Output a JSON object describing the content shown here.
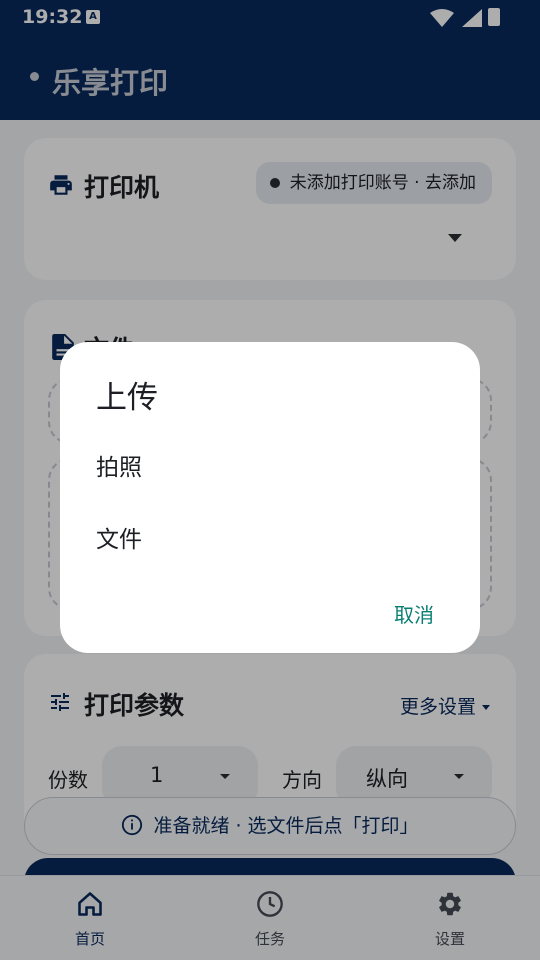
{
  "status_bar": {
    "time": "19:32",
    "badge": "A"
  },
  "app": {
    "title": "乐享打印"
  },
  "printer_card": {
    "title": "打印机",
    "chip_label": "未添加打印账号 · 去添加",
    "icon": "printer-icon"
  },
  "file_card": {
    "title": "文件",
    "icon": "file-icon"
  },
  "params_card": {
    "title": "打印参数",
    "more_label": "更多设置",
    "copies_label": "份数",
    "copies_value": "1",
    "orientation_label": "方向",
    "orientation_value": "纵向",
    "icon": "tune-icon"
  },
  "status_message": "准备就绪 · 选文件后点「打印」",
  "bottom_nav": [
    {
      "label": "首页",
      "icon": "home-icon",
      "active": true
    },
    {
      "label": "任务",
      "icon": "clock-icon",
      "active": false
    },
    {
      "label": "设置",
      "icon": "gear-icon",
      "active": false
    }
  ],
  "dialog": {
    "title": "上传",
    "options": [
      "拍照",
      "文件"
    ],
    "cancel_label": "取消"
  },
  "colors": {
    "primary": "#0a2a5c",
    "accent_teal": "#0b7e74",
    "background": "#f1f3f7",
    "scrim": "rgba(0,0,0,0.32)"
  }
}
